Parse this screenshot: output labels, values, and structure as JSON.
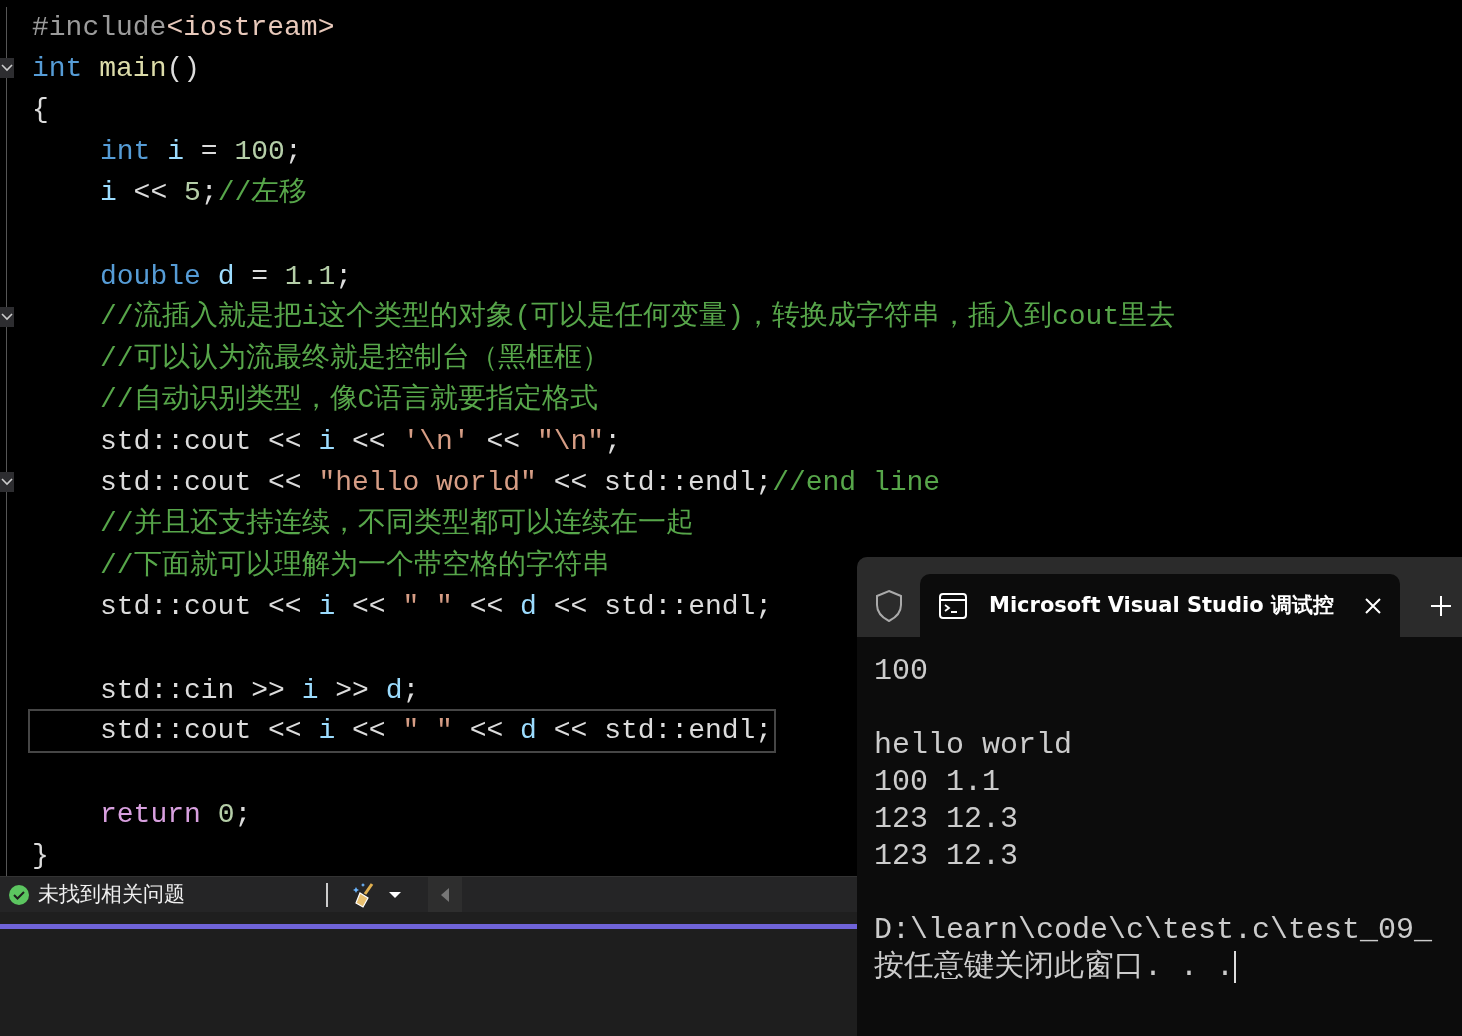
{
  "editor": {
    "lines": [
      {
        "tokens": [
          {
            "text": "#include",
            "kind": "preproc"
          },
          {
            "text": "<iostream>",
            "kind": "include"
          }
        ],
        "fold": false,
        "current": false,
        "blank_before": false
      },
      {
        "tokens": [
          {
            "text": "int",
            "kind": "keyword"
          },
          {
            "text": " main",
            "kind": "func"
          },
          {
            "text": "()",
            "kind": "plain"
          }
        ],
        "fold": true,
        "current": false,
        "blank_before": false
      },
      {
        "tokens": [
          {
            "text": "{",
            "kind": "plain"
          }
        ],
        "fold": false,
        "current": false,
        "blank_before": false,
        "children": [
          {
            "tokens": [
              {
                "text": "int",
                "kind": "keyword"
              },
              {
                "text": " i",
                "kind": "local"
              },
              {
                "text": " = ",
                "kind": "plain"
              },
              {
                "text": "100",
                "kind": "number"
              },
              {
                "text": ";",
                "kind": "plain"
              }
            ],
            "fold": false,
            "current": false,
            "blank_before": false
          },
          {
            "tokens": [
              {
                "text": "i",
                "kind": "local"
              },
              {
                "text": " << ",
                "kind": "plain"
              },
              {
                "text": "5",
                "kind": "number"
              },
              {
                "text": ";",
                "kind": "plain"
              },
              {
                "text": "//左移",
                "kind": "comment"
              }
            ],
            "fold": false,
            "current": false,
            "blank_before": false
          },
          {
            "tokens": [
              {
                "text": "double",
                "kind": "keyword"
              },
              {
                "text": " d",
                "kind": "local"
              },
              {
                "text": " = ",
                "kind": "plain"
              },
              {
                "text": "1.1",
                "kind": "number"
              },
              {
                "text": ";",
                "kind": "plain"
              }
            ],
            "fold": false,
            "current": false,
            "blank_before": true
          },
          {
            "tokens": [
              {
                "text": "//流插入就是把i这个类型的对象(可以是任何变量)，转换成字符串，插入到cout里去",
                "kind": "comment"
              }
            ],
            "fold": true,
            "current": false,
            "blank_before": false
          },
          {
            "tokens": [
              {
                "text": "//可以认为流最终就是控制台（黑框框）",
                "kind": "comment"
              }
            ],
            "fold": false,
            "current": false,
            "blank_before": false
          },
          {
            "tokens": [
              {
                "text": "//自动识别类型，像C语言就要指定格式",
                "kind": "comment"
              }
            ],
            "fold": false,
            "current": false,
            "blank_before": false
          },
          {
            "tokens": [
              {
                "text": "std::cout << ",
                "kind": "plain"
              },
              {
                "text": "i",
                "kind": "local"
              },
              {
                "text": " << ",
                "kind": "plain"
              },
              {
                "text": "'\\n'",
                "kind": "string"
              },
              {
                "text": " << ",
                "kind": "plain"
              },
              {
                "text": "\"\\n\"",
                "kind": "string"
              },
              {
                "text": ";",
                "kind": "plain"
              }
            ],
            "fold": false,
            "current": false,
            "blank_before": false
          },
          {
            "tokens": [
              {
                "text": "std::cout << ",
                "kind": "plain"
              },
              {
                "text": "\"hello world\"",
                "kind": "string"
              },
              {
                "text": " << std::endl;",
                "kind": "plain"
              },
              {
                "text": "//end line",
                "kind": "comment"
              }
            ],
            "fold": true,
            "current": false,
            "blank_before": false
          },
          {
            "tokens": [
              {
                "text": "//并且还支持连续，不同类型都可以连续在一起",
                "kind": "comment"
              }
            ],
            "fold": false,
            "current": false,
            "blank_before": false
          },
          {
            "tokens": [
              {
                "text": "//下面就可以理解为一个带空格的字符串",
                "kind": "comment"
              }
            ],
            "fold": false,
            "current": false,
            "blank_before": false
          },
          {
            "tokens": [
              {
                "text": "std::cout << ",
                "kind": "plain"
              },
              {
                "text": "i",
                "kind": "local"
              },
              {
                "text": " << ",
                "kind": "plain"
              },
              {
                "text": "\" \"",
                "kind": "string"
              },
              {
                "text": " << ",
                "kind": "plain"
              },
              {
                "text": "d",
                "kind": "local"
              },
              {
                "text": " << std::endl;",
                "kind": "plain"
              }
            ],
            "fold": false,
            "current": false,
            "blank_before": false
          },
          {
            "tokens": [
              {
                "text": "std::cin >> ",
                "kind": "plain"
              },
              {
                "text": "i",
                "kind": "local"
              },
              {
                "text": " >> ",
                "kind": "plain"
              },
              {
                "text": "d",
                "kind": "local"
              },
              {
                "text": ";",
                "kind": "plain"
              }
            ],
            "fold": false,
            "current": false,
            "blank_before": true
          },
          {
            "tokens": [
              {
                "text": "std::cout << ",
                "kind": "plain"
              },
              {
                "text": "i",
                "kind": "local"
              },
              {
                "text": " << ",
                "kind": "plain"
              },
              {
                "text": "\" \"",
                "kind": "string"
              },
              {
                "text": " << ",
                "kind": "plain"
              },
              {
                "text": "d",
                "kind": "local"
              },
              {
                "text": " << std::endl;",
                "kind": "plain"
              }
            ],
            "fold": false,
            "current": true,
            "blank_before": false
          },
          {
            "tokens": [
              {
                "text": "return",
                "kind": "control"
              },
              {
                "text": " 0",
                "kind": "number"
              },
              {
                "text": ";",
                "kind": "plain"
              }
            ],
            "fold": false,
            "current": false,
            "blank_before": true
          }
        ]
      },
      {
        "tokens": [
          {
            "text": "}",
            "kind": "plain"
          }
        ],
        "fold": false,
        "current": false,
        "blank_before": false
      }
    ]
  },
  "status_bar": {
    "issues": "未找到相关问题"
  },
  "terminal": {
    "tab_title": "Microsoft Visual Studio 调试控",
    "cursor": true,
    "lines": [
      {
        "text": "100",
        "blank_before": false
      },
      {
        "text": "hello world",
        "blank_before": true
      },
      {
        "text": "100 1.1",
        "blank_before": false
      },
      {
        "text": "123 12.3",
        "blank_before": false
      },
      {
        "text": "123 12.3",
        "blank_before": false
      },
      {
        "text": "D:\\learn\\code\\c\\test.c\\test_09_",
        "blank_before": true
      },
      {
        "text": "按任意键关闭此窗口. . .",
        "blank_before": false
      }
    ]
  }
}
